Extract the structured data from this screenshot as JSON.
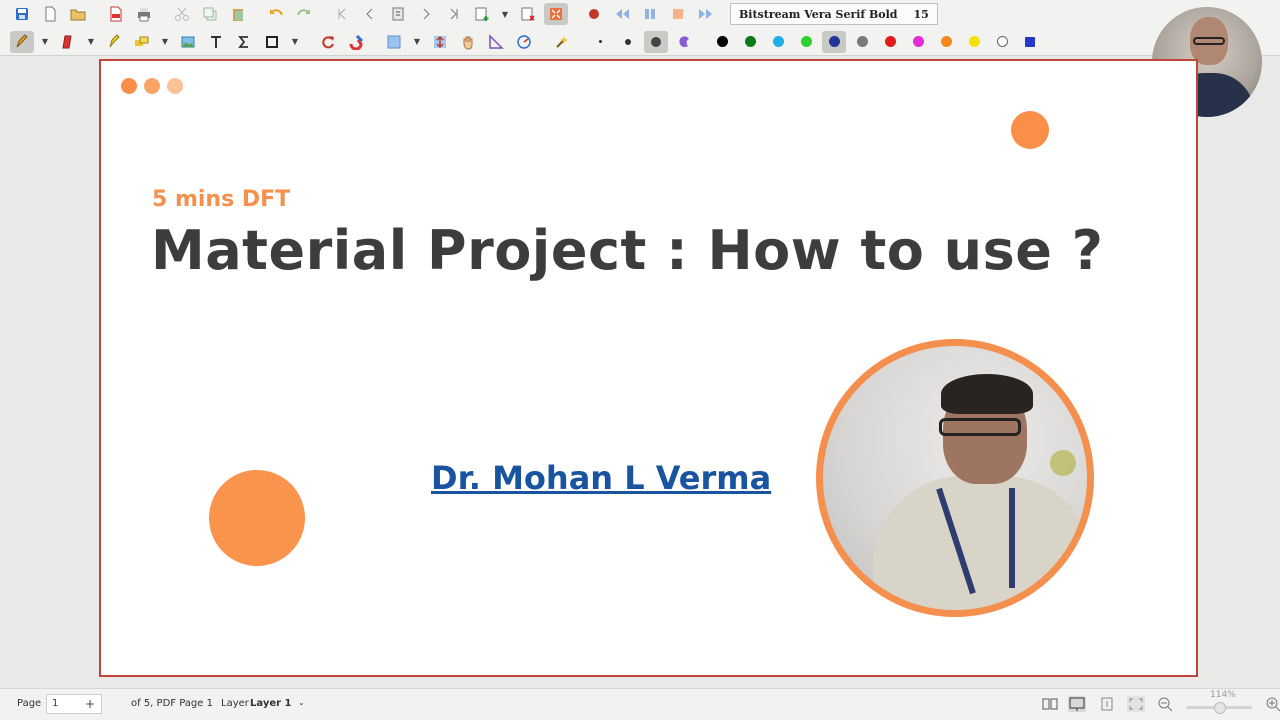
{
  "toolbar": {
    "font_name": "Bitstream Vera Serif Bold",
    "font_size": "15",
    "pen_colors": [
      "#000000",
      "#0b7a16",
      "#1fb0e8",
      "#2ed02e",
      "#23349a",
      "#7a7a7a",
      "#e01b1b",
      "#e22ad8",
      "#f7881c",
      "#f5e000",
      "#ffffff",
      "#2536c9"
    ],
    "accent_record": "#c0392b"
  },
  "slide": {
    "subtitle": "5 mins DFT",
    "title": "Material Project : How to use ?",
    "author": "Dr. Mohan L Verma",
    "accent_color": "#fa8f48",
    "title_color": "#3d3d3d",
    "author_color": "#1854a0"
  },
  "statusbar": {
    "page_label": "Page",
    "page_value": "1",
    "page_of": "of 5, PDF Page 1",
    "layer_label": "Layer",
    "layer_value": "Layer 1",
    "zoom": "114%"
  }
}
